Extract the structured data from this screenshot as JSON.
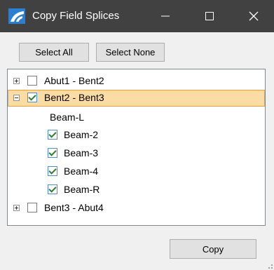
{
  "window": {
    "title": "Copy Field Splices",
    "colors": {
      "titlebar": "#414141",
      "selection": "#fcdca5",
      "check": "#2e7d32"
    }
  },
  "toolbar": {
    "select_all_label": "Select All",
    "select_none_label": "Select None"
  },
  "tree": {
    "groups": [
      {
        "label": "Abut1 - Bent2",
        "expanded": false,
        "checked": false,
        "selected": false
      },
      {
        "label": "Bent2 - Bent3",
        "expanded": true,
        "checked": true,
        "selected": true,
        "children": [
          {
            "label": "Beam-L",
            "has_checkbox": false
          },
          {
            "label": "Beam-2",
            "has_checkbox": true,
            "checked": true
          },
          {
            "label": "Beam-3",
            "has_checkbox": true,
            "checked": true
          },
          {
            "label": "Beam-4",
            "has_checkbox": true,
            "checked": true
          },
          {
            "label": "Beam-R",
            "has_checkbox": true,
            "checked": true
          }
        ]
      },
      {
        "label": "Bent3 - Abut4",
        "expanded": false,
        "checked": false,
        "selected": false
      }
    ]
  },
  "footer": {
    "copy_label": "Copy"
  },
  "icons": [
    "app-logo-icon",
    "minimize-icon",
    "maximize-icon",
    "close-icon",
    "expand-icon",
    "collapse-icon",
    "checkbox-icon",
    "resize-grip-icon"
  ]
}
